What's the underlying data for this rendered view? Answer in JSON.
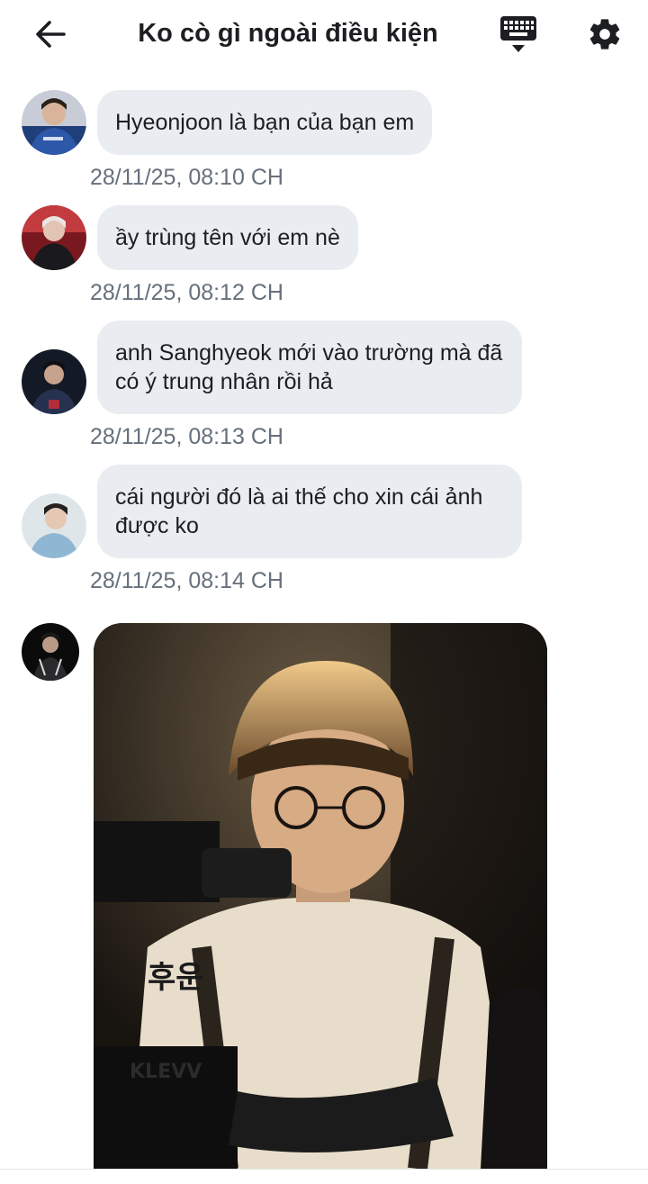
{
  "header": {
    "title": "Ko cò gì ngoài điều kiện",
    "back_icon": "back-arrow-icon",
    "keyboard_icon": "keyboard-icon",
    "settings_icon": "gear-icon"
  },
  "messages": [
    {
      "text": "Hyeonjoon là bạn của bạn em",
      "time": "28/11/25, 08:10 CH"
    },
    {
      "text": "ầy trùng tên với em nè",
      "time": "28/11/25, 08:12 CH"
    },
    {
      "text": "anh Sanghyeok mới vào trường mà đã có ý trung nhân rồi hả",
      "time": "28/11/25, 08:13 CH"
    },
    {
      "text": "cái người đó là ai thế cho xin cái ảnh được ko",
      "time": "28/11/25, 08:14 CH"
    }
  ],
  "photo_message": {
    "jersey_text_1": "KLEVV",
    "jersey_text_2": "후운"
  },
  "colors": {
    "bubble_bg": "#e9ecf1",
    "timestamp": "#66707c",
    "text": "#1c1e21"
  }
}
